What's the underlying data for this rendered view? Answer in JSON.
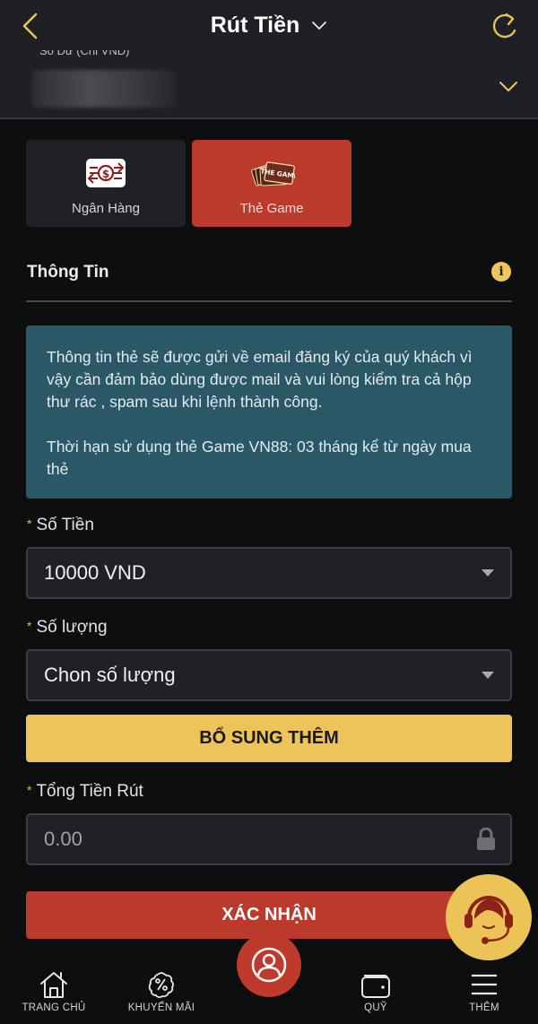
{
  "header": {
    "title": "Rút Tiền",
    "back_icon": "chevron-left-icon",
    "refresh_icon": "refresh-icon",
    "balance_label": "Số Dư (Chỉ VND)",
    "balance_value_hidden": "0.00",
    "expand_icon": "chevron-down-icon"
  },
  "methods": [
    {
      "label": "Ngân Hàng",
      "icon": "bank-transfer-icon",
      "active": false
    },
    {
      "label": "Thẻ Game",
      "icon": "game-card-icon",
      "active": true
    }
  ],
  "section": {
    "title": "Thông Tin",
    "info_icon": "info-icon"
  },
  "notice": {
    "paragraph1": "Thông tin thẻ sẽ được gửi về email đăng ký của quý khách vì vậy cần đảm bảo dùng được mail và vui lòng kiểm tra cả hộp thư rác , spam sau khi lệnh thành công.",
    "paragraph2": "Thời hạn sử dụng thẻ Game VN88: 03 tháng kể từ ngày mua thẻ"
  },
  "form": {
    "required_mark": "*",
    "amount": {
      "label": "Số Tiền",
      "value": "10000 VND"
    },
    "quantity": {
      "label": "Số lượng",
      "placeholder": "Chon số lượng"
    },
    "add_more_label": "BỔ SUNG THÊM",
    "total": {
      "label": "Tổng Tiền Rút",
      "value": "0.00",
      "locked": true
    },
    "confirm_label": "XÁC NHẬN"
  },
  "support_icon": "customer-support-icon",
  "bottom_nav": [
    {
      "label": "TRANG CHỦ",
      "icon": "home-icon"
    },
    {
      "label": "KHUYẾN MÃI",
      "icon": "promotion-icon"
    },
    {
      "label": "",
      "icon": "account-icon"
    },
    {
      "label": "QUỸ",
      "icon": "wallet-icon"
    },
    {
      "label": "THÊM",
      "icon": "menu-icon"
    }
  ],
  "colors": {
    "accent_gold": "#eec45a",
    "accent_red": "#bb3a2c",
    "notice_bg": "#2b5866",
    "header_bg": "#1e2025",
    "page_bg": "#0d0e10"
  }
}
